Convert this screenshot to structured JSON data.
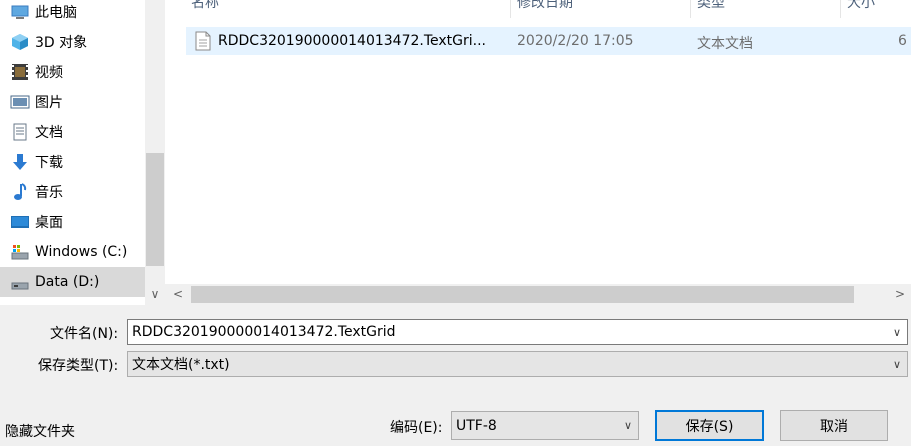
{
  "nav": {
    "items": [
      {
        "label": "此电脑",
        "icon": "computer-icon"
      },
      {
        "label": "3D 对象",
        "icon": "3d-objects-icon"
      },
      {
        "label": "视频",
        "icon": "video-icon"
      },
      {
        "label": "图片",
        "icon": "pictures-icon"
      },
      {
        "label": "文档",
        "icon": "documents-icon"
      },
      {
        "label": "下载",
        "icon": "download-icon"
      },
      {
        "label": "音乐",
        "icon": "music-icon"
      },
      {
        "label": "桌面",
        "icon": "desktop-icon"
      },
      {
        "label": "Windows (C:)",
        "icon": "drive-icon"
      },
      {
        "label": "Data (D:)",
        "icon": "drive-icon",
        "selected": true
      }
    ]
  },
  "columns": {
    "name": "名称",
    "modified": "修改日期",
    "type": "类型",
    "size": "大小"
  },
  "files": [
    {
      "name": "RDDC320190000014013472.TextGri...",
      "modified": "2020/2/20 17:05",
      "type": "文本文档",
      "size": "6"
    }
  ],
  "form": {
    "filename_label": "文件名(N):",
    "filename_value": "RDDC320190000014013472.TextGrid",
    "filetype_label": "保存类型(T):",
    "filetype_value": "文本文档(*.txt)",
    "hide_folders_label": "隐藏文件夹",
    "encoding_label": "编码(E):",
    "encoding_value": "UTF-8",
    "save_label": "保存(S)",
    "cancel_label": "取消"
  },
  "colors": {
    "selection": "#e5f3ff",
    "nav_selected": "#d9d9d9",
    "header_text": "#4c607a",
    "accent": "#0078d7"
  }
}
